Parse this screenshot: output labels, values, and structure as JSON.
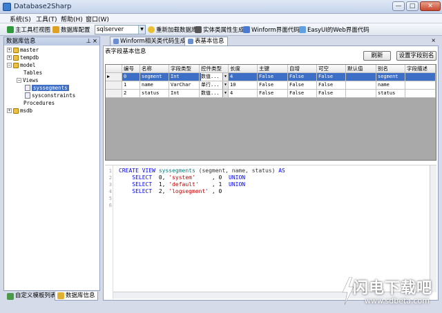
{
  "window": {
    "title": "Database2Sharp",
    "minimize": "—",
    "maximize": "□",
    "close": "✕"
  },
  "menu": [
    "系统(S)",
    "工具(T)",
    "帮助(H)",
    "窗口(W)"
  ],
  "toolbar": {
    "main_toolbar_view": "主工具栏视图",
    "db_config": "数据库配置",
    "db_type": "sqlserver",
    "reload_db": "重新加载数据库",
    "entity_gen": "实体类属性生成",
    "winform_code": "Winform界面代码",
    "easyui_code": "EasyUI的Web界面代码"
  },
  "left_panel": {
    "title": "数据库信息",
    "pin": "⊥",
    "close": "×",
    "tree": {
      "master": "master",
      "tempdb": "tempdb",
      "model": "model",
      "tables": "Tables",
      "views": "Views",
      "syssegments": "syssegments",
      "sysconstraints": "sysconstraints",
      "procedures": "Procedures",
      "msdb": "msdb"
    },
    "tabs": {
      "custom_templates": "自定义模板列表",
      "db_info": "数据库信息"
    }
  },
  "doc_tabs": {
    "winform_tab": "Winform相关类代码生成",
    "table_info_tab": "表基本信息",
    "close": "×"
  },
  "content": {
    "section_title": "表字段基本信息",
    "refresh": "刷新",
    "set_alias": "设置字段别名",
    "grid": {
      "headers": [
        "编号",
        "名称",
        "字段类型",
        "控件类型",
        "长度",
        "主键",
        "自增",
        "可空",
        "默认值",
        "别名",
        "字段描述"
      ],
      "rows": [
        [
          "0",
          "segment",
          "Int",
          "数值...",
          "4",
          "False",
          "False",
          "False",
          "",
          "segment",
          ""
        ],
        [
          "1",
          "name",
          "VarChar",
          "单行...",
          "10",
          "False",
          "False",
          "False",
          "",
          "name",
          ""
        ],
        [
          "2",
          "status",
          "Int",
          "数值...",
          "4",
          "False",
          "False",
          "False",
          "",
          "status",
          ""
        ]
      ],
      "row_marker": "▶"
    },
    "code": {
      "line_numbers": [
        "1",
        "2",
        "3",
        "4",
        "5",
        "6"
      ],
      "l1_kw1": "CREATE VIEW",
      "l1_name": "syssegments",
      "l1_rest": "(segment, name, status)",
      "l1_kw2": "AS",
      "l2_kw": "SELECT",
      "l2_num": "0,",
      "l2_str": "'system'",
      "l2_num2": ", 0",
      "l2_kw2": "UNION",
      "l3_kw": "SELECT",
      "l3_num": "1,",
      "l3_str": "'default'",
      "l3_num2": ", 1",
      "l3_kw2": "UNION",
      "l4_kw": "SELECT",
      "l4_num": "2,",
      "l4_str": "'logsegment'",
      "l4_num2": ", 0"
    }
  },
  "watermark": {
    "cn": "闪电下载吧",
    "url": "www.sdbeta.com"
  },
  "colors": {
    "selection": "#3d6fc7",
    "keyword": "#0000ff",
    "string": "#c00000"
  }
}
